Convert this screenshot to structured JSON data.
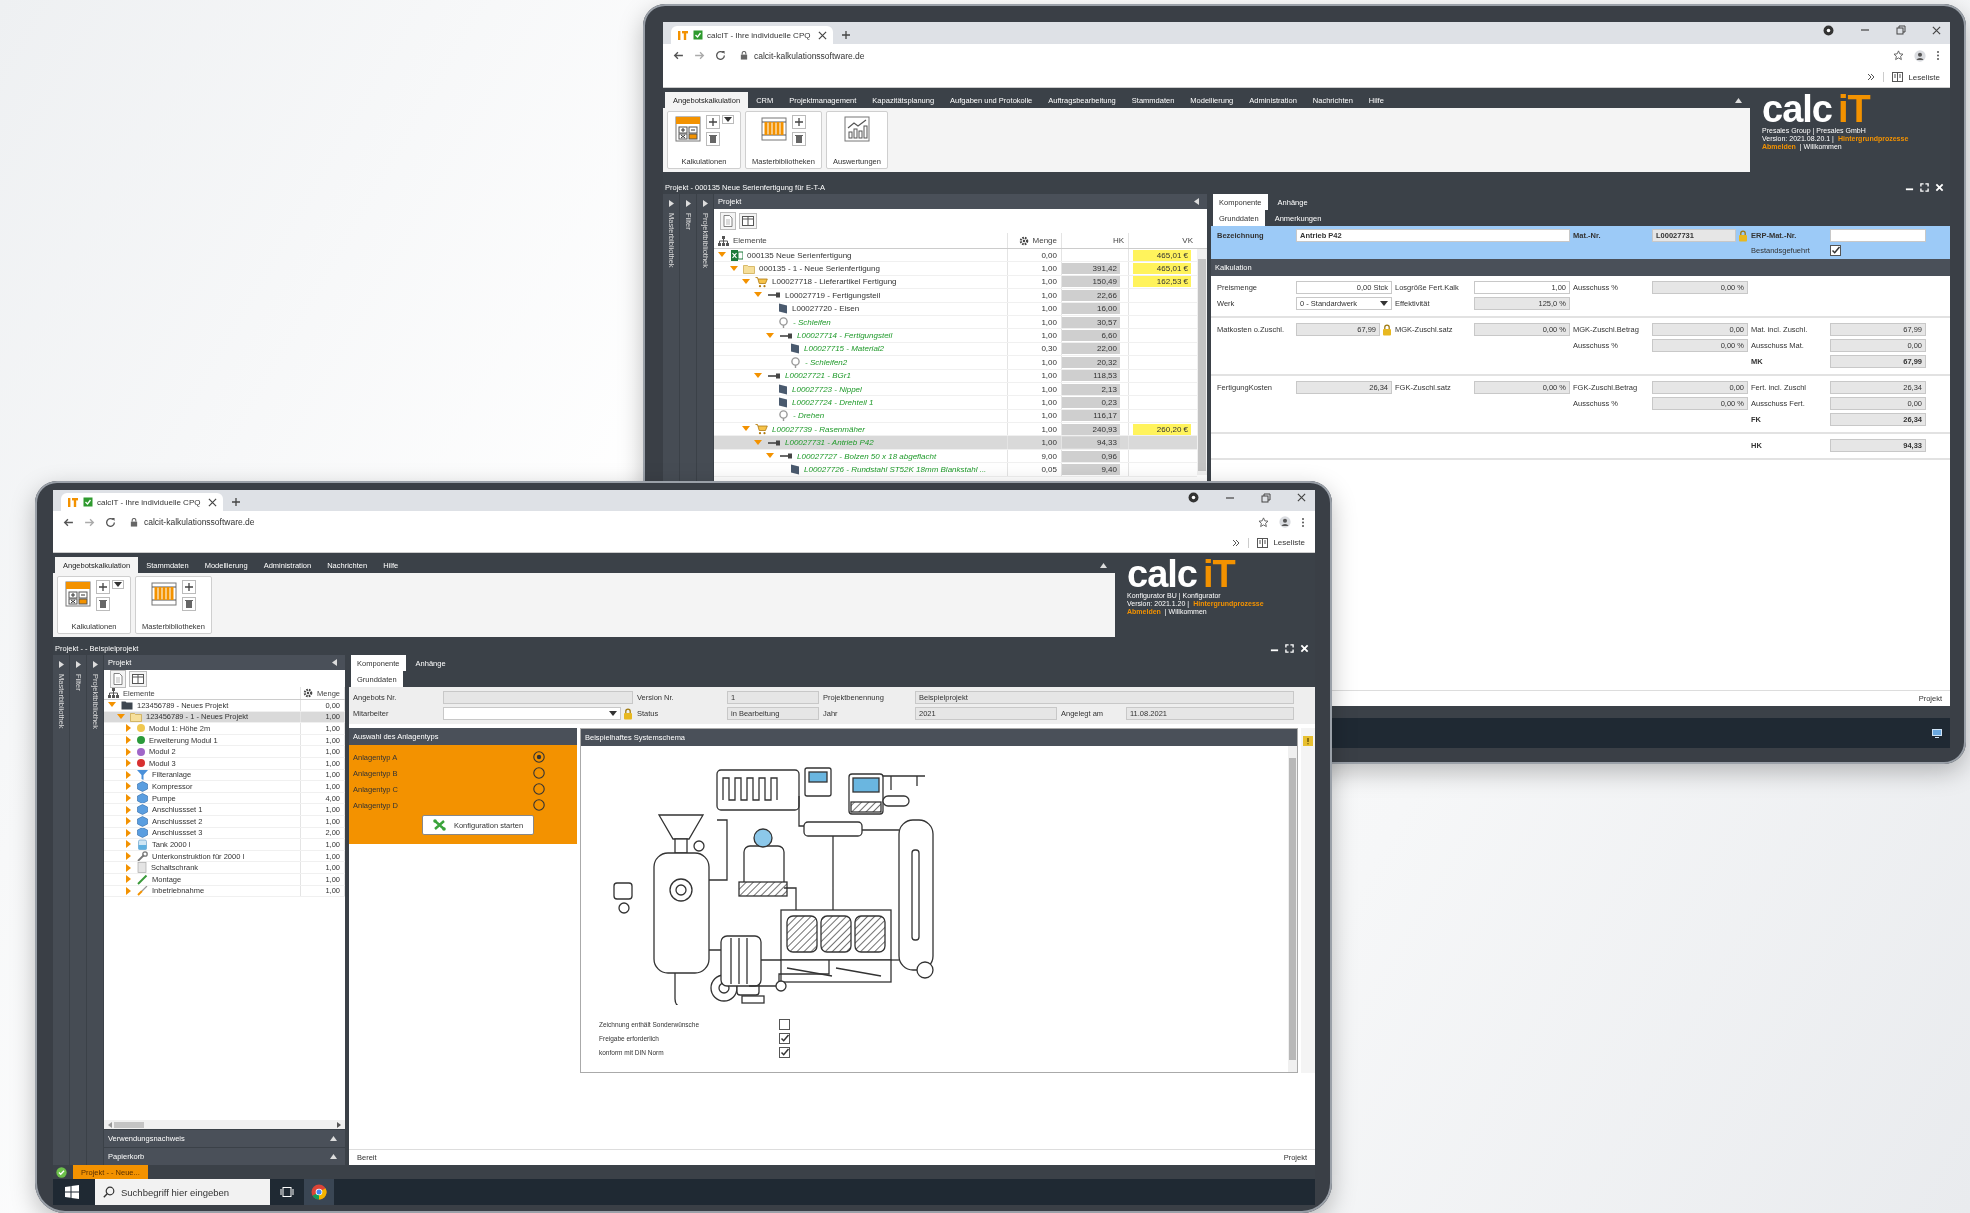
{
  "back_window": {
    "browser": {
      "tab_title": "calcIT - Ihre individuelle CPQ",
      "url": "calcit-kalkulationssoftware.de",
      "reading_list": "Leseliste"
    },
    "menu": [
      {
        "label": "Angebotskalkulation",
        "selected": true
      },
      {
        "label": "CRM",
        "selected": false
      },
      {
        "label": "Projektmanagement",
        "selected": false
      },
      {
        "label": "Kapazitätsplanung",
        "selected": false
      },
      {
        "label": "Aufgaben und Protokolle",
        "selected": false
      },
      {
        "label": "Auftragsbearbeitung",
        "selected": false
      },
      {
        "label": "Stammdaten",
        "selected": false
      },
      {
        "label": "Modellierung",
        "selected": false
      },
      {
        "label": "Administration",
        "selected": false
      },
      {
        "label": "Nachrichten",
        "selected": false
      },
      {
        "label": "Hilfe",
        "selected": false
      }
    ],
    "ribbon": [
      {
        "label": "Kalkulationen",
        "kind": "calculations"
      },
      {
        "label": "Masterbibliotheken",
        "kind": "library"
      },
      {
        "label": "Auswertungen",
        "kind": "reports"
      }
    ],
    "logo_panel": {
      "wordmark": "calc",
      "wordmark_accent": "iT",
      "company": "Presales Group | Presales GmbH",
      "version": "Version: 2021.08.20.1 |",
      "processes_link": "Hintergrundprozesse",
      "logout_link": "Abmelden",
      "welcome": "| Willkommen"
    },
    "title": "Projekt - 000135 Neue Serienfertigung für E-T-A",
    "side_tabs": [
      "Masterbibliothek",
      "Filter",
      "Projektbibliothek"
    ],
    "tree": {
      "title": "Projekt",
      "columns": [
        "Elemente",
        "Menge",
        "HK",
        "VK"
      ],
      "rows": [
        {
          "label": "000135 Neue Serienfertigung",
          "kind": "project",
          "quantity": "0,00",
          "vk": "465,01 €",
          "expanded": true,
          "selected": false,
          "emphasized": false,
          "children": [
            {
              "label": "000135 - 1 - Neue Serienfertigung",
              "kind": "offer",
              "quantity": "1,00",
              "hk": "391,42",
              "vk": "465,01 €",
              "expanded": true,
              "selected": false,
              "emphasized": false,
              "children": [
                {
                  "label": "L00027718 - Lieferartikel Fertigung",
                  "kind": "cart",
                  "quantity": "1,00",
                  "hk": "150,49",
                  "vk": "162,53 €",
                  "expanded": true,
                  "selected": false,
                  "emphasized": false,
                  "children": [
                    {
                      "label": "L00027719 - Fertigungsteil",
                      "kind": "part",
                      "quantity": "1,00",
                      "hk": "22,66",
                      "expanded": true,
                      "selected": false,
                      "emphasized": false,
                      "children": [
                        {
                          "label": "L00027720 - Eisen",
                          "kind": "material",
                          "quantity": "1,00",
                          "hk": "16,00",
                          "selected": false,
                          "emphasized": false
                        },
                        {
                          "label": "- Schleifen",
                          "kind": "operation",
                          "quantity": "1,00",
                          "hk": "30,57",
                          "selected": false,
                          "emphasized": true
                        },
                        {
                          "label": "L00027714 - Fertigungsteil",
                          "kind": "part",
                          "quantity": "1,00",
                          "hk": "6,60",
                          "expanded": true,
                          "selected": false,
                          "emphasized": true,
                          "children": [
                            {
                              "label": "L00027715 - Material2",
                              "kind": "material",
                              "quantity": "0,30",
                              "hk": "22,00",
                              "selected": false,
                              "emphasized": true
                            },
                            {
                              "label": "- Schleifen2",
                              "kind": "operation",
                              "quantity": "1,00",
                              "hk": "20,32",
                              "selected": false,
                              "emphasized": true
                            }
                          ]
                        }
                      ]
                    },
                    {
                      "label": "L00027721 - BGr1",
                      "kind": "part",
                      "quantity": "1,00",
                      "hk": "118,53",
                      "expanded": true,
                      "selected": false,
                      "emphasized": true,
                      "children": [
                        {
                          "label": "L00027723 - Nippel",
                          "kind": "material",
                          "quantity": "1,00",
                          "hk": "2,13",
                          "selected": false,
                          "emphasized": true
                        },
                        {
                          "label": "L00027724 - Drehteil 1",
                          "kind": "material",
                          "quantity": "1,00",
                          "hk": "0,23",
                          "selected": false,
                          "emphasized": true
                        },
                        {
                          "label": "- Drehen",
                          "kind": "operation",
                          "quantity": "1,00",
                          "hk": "116,17",
                          "selected": false,
                          "emphasized": true
                        }
                      ]
                    }
                  ]
                },
                {
                  "label": "L00027739 - Rasenmäher",
                  "kind": "cart",
                  "quantity": "1,00",
                  "hk": "240,93",
                  "vk": "260,20 €",
                  "expanded": true,
                  "selected": false,
                  "emphasized": true,
                  "children": [
                    {
                      "label": "L00027731 - Antrieb P42",
                      "kind": "part",
                      "quantity": "1,00",
                      "hk": "94,33",
                      "expanded": true,
                      "selected": true,
                      "emphasized": true,
                      "children": [
                        {
                          "label": "L00027727 - Bolzen 50 x 18 abgeflacht",
                          "kind": "part",
                          "quantity": "9,00",
                          "hk": "0,96",
                          "expanded": true,
                          "selected": false,
                          "emphasized": true,
                          "children": [
                            {
                              "label": "L00027726 - Rundstahl ST52K 18mm Blankstahl ...",
                              "kind": "material",
                              "quantity": "0,05",
                              "hk": "9,40",
                              "selected": false,
                              "emphasized": true
                            }
                          ]
                        }
                      ]
                    }
                  ]
                }
              ]
            }
          ]
        }
      ]
    },
    "panel_tabs": [
      {
        "label": "Komponente",
        "selected": true
      },
      {
        "label": "Anhänge",
        "selected": false
      }
    ],
    "sub_tabs": [
      {
        "label": "Grunddaten",
        "selected": true
      },
      {
        "label": "Anmerkungen",
        "selected": false
      }
    ],
    "header_fields": [
      {
        "label": "Bezeichnung",
        "value": "Antrieb P42",
        "kind": "input",
        "wide": true
      },
      {
        "label": "Mat.-Nr.",
        "value": "L00027731",
        "kind": "locked",
        "wide": false
      },
      {
        "label": "ERP-Mat.-Nr.",
        "kind": "input",
        "wide": false
      }
    ],
    "stock_check": {
      "label": "Bestandsgefuehrt",
      "checked": true
    },
    "calc_title": "Kalkulation",
    "calc_sections": [
      {
        "rows": [
          [
            {
              "label": "Preismenge",
              "value": "0,00 Stck",
              "kind": "input"
            },
            {
              "label": "Losgröße Fert.Kalk",
              "value": "1,00",
              "kind": "input"
            },
            {
              "label": "Ausschuss %",
              "value": "0,00 %",
              "kind": "readonly"
            },
            null
          ],
          [
            {
              "label": "Werk",
              "value": "0 - Standardwerk",
              "kind": "dropdown"
            },
            {
              "label": "Effektivität",
              "value": "125,0 %",
              "kind": "readonly"
            },
            null,
            null
          ]
        ]
      },
      {
        "rows": [
          [
            {
              "label": "Matkosten o.Zuschl.",
              "value": "67,99",
              "kind": "locked"
            },
            {
              "label": "MGK-Zuschl.satz",
              "value": "0,00 %",
              "kind": "readonly"
            },
            {
              "label": "MGK-Zuschl.Betrag",
              "value": "0,00",
              "kind": "readonly"
            },
            {
              "label": "Mat. incl. Zuschl.",
              "value": "67,99",
              "kind": "readonly"
            }
          ],
          [
            null,
            null,
            {
              "label": "Ausschuss %",
              "value": "0,00 %",
              "kind": "readonly"
            },
            {
              "label": "Ausschuss Mat.",
              "value": "0,00",
              "kind": "readonly"
            }
          ],
          [
            null,
            null,
            null,
            {
              "label": "MK",
              "value": "67,99",
              "kind": "total"
            }
          ]
        ]
      },
      {
        "rows": [
          [
            {
              "label": "FertigungKosten",
              "value": "26,34",
              "kind": "readonly"
            },
            {
              "label": "FGK-Zuschl.satz",
              "value": "0,00 %",
              "kind": "readonly"
            },
            {
              "label": "FGK-Zuschl.Betrag",
              "value": "0,00",
              "kind": "readonly"
            },
            {
              "label": "Fert. incl. Zuschl",
              "value": "26,34",
              "kind": "readonly"
            }
          ],
          [
            null,
            null,
            {
              "label": "Ausschuss %",
              "value": "0,00 %",
              "kind": "readonly"
            },
            {
              "label": "Ausschuss Fert.",
              "value": "0,00",
              "kind": "readonly"
            }
          ],
          [
            null,
            null,
            null,
            {
              "label": "FK",
              "value": "26,34",
              "kind": "total"
            }
          ]
        ]
      },
      {
        "rows": [
          [
            null,
            null,
            null,
            {
              "label": "HK",
              "value": "94,33",
              "kind": "total"
            }
          ]
        ]
      }
    ],
    "status_bar": {
      "right": "Projekt"
    }
  },
  "front_window": {
    "browser": {
      "tab_title": "calcIT - Ihre individuelle CPQ",
      "url": "calcit-kalkulationssoftware.de",
      "reading_list": "Leseliste"
    },
    "menu": [
      {
        "label": "Angebotskalkulation",
        "selected": true
      },
      {
        "label": "Stammdaten",
        "selected": false
      },
      {
        "label": "Modellierung",
        "selected": false
      },
      {
        "label": "Administration",
        "selected": false
      },
      {
        "label": "Nachrichten",
        "selected": false
      },
      {
        "label": "Hilfe",
        "selected": false
      }
    ],
    "ribbon": [
      {
        "label": "Kalkulationen",
        "kind": "calculations"
      },
      {
        "label": "Masterbibliotheken",
        "kind": "library"
      }
    ],
    "logo_panel": {
      "wordmark": "calc",
      "wordmark_accent": "iT",
      "company": "Konfigurator BU | Konfigurator",
      "version": "Version: 2021.1.20 |",
      "processes_link": "Hintergrundprozesse",
      "logout_link": "Abmelden",
      "welcome": "| Willkommen"
    },
    "title": "Projekt - - Beispielprojekt",
    "side_tabs": [
      "Masterbibliothek",
      "Filter",
      "Projektbibliothek"
    ],
    "tree": {
      "title": "Projekt",
      "columns": [
        "Elemente",
        "Menge"
      ],
      "rows": [
        {
          "label": "123456789 - Neues Projekt",
          "kind": "folder",
          "quantity": "0,00",
          "expanded": true,
          "selected": false,
          "children": [
            {
              "label": "123456789 - 1 - Neues Projekt",
              "kind": "offer",
              "quantity": "1,00",
              "expanded": true,
              "selected": true,
              "children": [
                {
                  "label": "Modul 1: Höhe 2m",
                  "kind": "module",
                  "color": "#f0c850",
                  "quantity": "1,00",
                  "expanded": false,
                  "selected": false
                },
                {
                  "label": "Erweiterung Modul 1",
                  "kind": "module",
                  "color": "#2a9a3a",
                  "quantity": "1,00",
                  "expanded": false,
                  "selected": false
                },
                {
                  "label": "Modul 2",
                  "kind": "module",
                  "color": "#a066c8",
                  "quantity": "1,00",
                  "expanded": false,
                  "selected": false
                },
                {
                  "label": "Modul 3",
                  "kind": "module",
                  "color": "#d83030",
                  "quantity": "1,00",
                  "expanded": false,
                  "selected": false
                },
                {
                  "label": "Filteranlage",
                  "kind": "filter",
                  "quantity": "1,00",
                  "expanded": false,
                  "selected": false
                },
                {
                  "label": "Kompressor",
                  "kind": "cube",
                  "quantity": "1,00",
                  "expanded": false,
                  "selected": false
                },
                {
                  "label": "Pumpe",
                  "kind": "cube",
                  "quantity": "4,00",
                  "expanded": false,
                  "selected": false
                },
                {
                  "label": "Anschlussset 1",
                  "kind": "cube",
                  "quantity": "1,00",
                  "expanded": false,
                  "selected": false
                },
                {
                  "label": "Anschlussset 2",
                  "kind": "cube",
                  "quantity": "1,00",
                  "expanded": false,
                  "selected": false
                },
                {
                  "label": "Anschlussset 3",
                  "kind": "cube",
                  "quantity": "2,00",
                  "expanded": false,
                  "selected": false
                },
                {
                  "label": "Tank 2000 l",
                  "kind": "tank",
                  "quantity": "1,00",
                  "expanded": false,
                  "selected": false
                },
                {
                  "label": "Unterkonstruktion für 2000 l",
                  "kind": "wrench",
                  "quantity": "1,00",
                  "expanded": false,
                  "selected": false
                },
                {
                  "label": "Schaltschrank",
                  "kind": "cabinet",
                  "quantity": "1,00",
                  "expanded": false,
                  "selected": false
                },
                {
                  "label": "Montage",
                  "kind": "pen",
                  "quantity": "1,00",
                  "expanded": false,
                  "selected": false
                },
                {
                  "label": "Inbetriebnahme",
                  "kind": "tool",
                  "quantity": "1,00",
                  "expanded": false,
                  "selected": false
                }
              ]
            }
          ]
        }
      ]
    },
    "collapsed_panels": [
      "Verwendungsnachweis",
      "Papierkorb"
    ],
    "panel_tabs": [
      {
        "label": "Komponente",
        "selected": true
      },
      {
        "label": "Anhänge",
        "selected": false
      }
    ],
    "sub_tabs": [
      {
        "label": "Grunddaten",
        "selected": true
      }
    ],
    "offer_form": [
      [
        {
          "label": "Angebots Nr.",
          "kind": "readonly",
          "wide": false
        },
        {
          "label": "Version Nr.",
          "value": "1",
          "kind": "readonly",
          "wide": false
        },
        {
          "label": "Projektbenennung",
          "value": "Beispielprojekt",
          "kind": "readonly",
          "wide": true
        }
      ],
      [
        {
          "label": "Mitarbeiter",
          "kind": "dropdown",
          "wide": false
        },
        {
          "label": "Status",
          "value": "in Bearbeitung",
          "kind": "readonly",
          "wide": false
        },
        {
          "label": "Jahr",
          "value": "2021",
          "kind": "readonly",
          "wide": false
        },
        {
          "label": "Angelegt am",
          "value": "11.08.2021",
          "kind": "readonly",
          "wide": false
        }
      ]
    ],
    "type_selection": {
      "title": "Auswahl des Anlagentyps",
      "options": [
        {
          "label": "Anlagentyp A",
          "selected": true
        },
        {
          "label": "Anlagentyp B",
          "selected": false
        },
        {
          "label": "Anlagentyp C",
          "selected": false
        },
        {
          "label": "Anlagentyp D",
          "selected": false
        }
      ],
      "button": "Konfiguration starten"
    },
    "schema": {
      "title": "Beispielhaftes Systemschema",
      "checks": [
        {
          "label": "Zeichnung enthält Sonderwünsche",
          "checked": false
        },
        {
          "label": "Freigabe erforderlich",
          "checked": true
        },
        {
          "label": "konform mit DIN Norm",
          "checked": true
        }
      ]
    },
    "status_bar": {
      "left": "Bereit",
      "right": "Projekt"
    },
    "open_tab": "Projekt - - Neue...",
    "taskbar": {
      "search_placeholder": "Suchbegriff hier eingeben"
    }
  }
}
